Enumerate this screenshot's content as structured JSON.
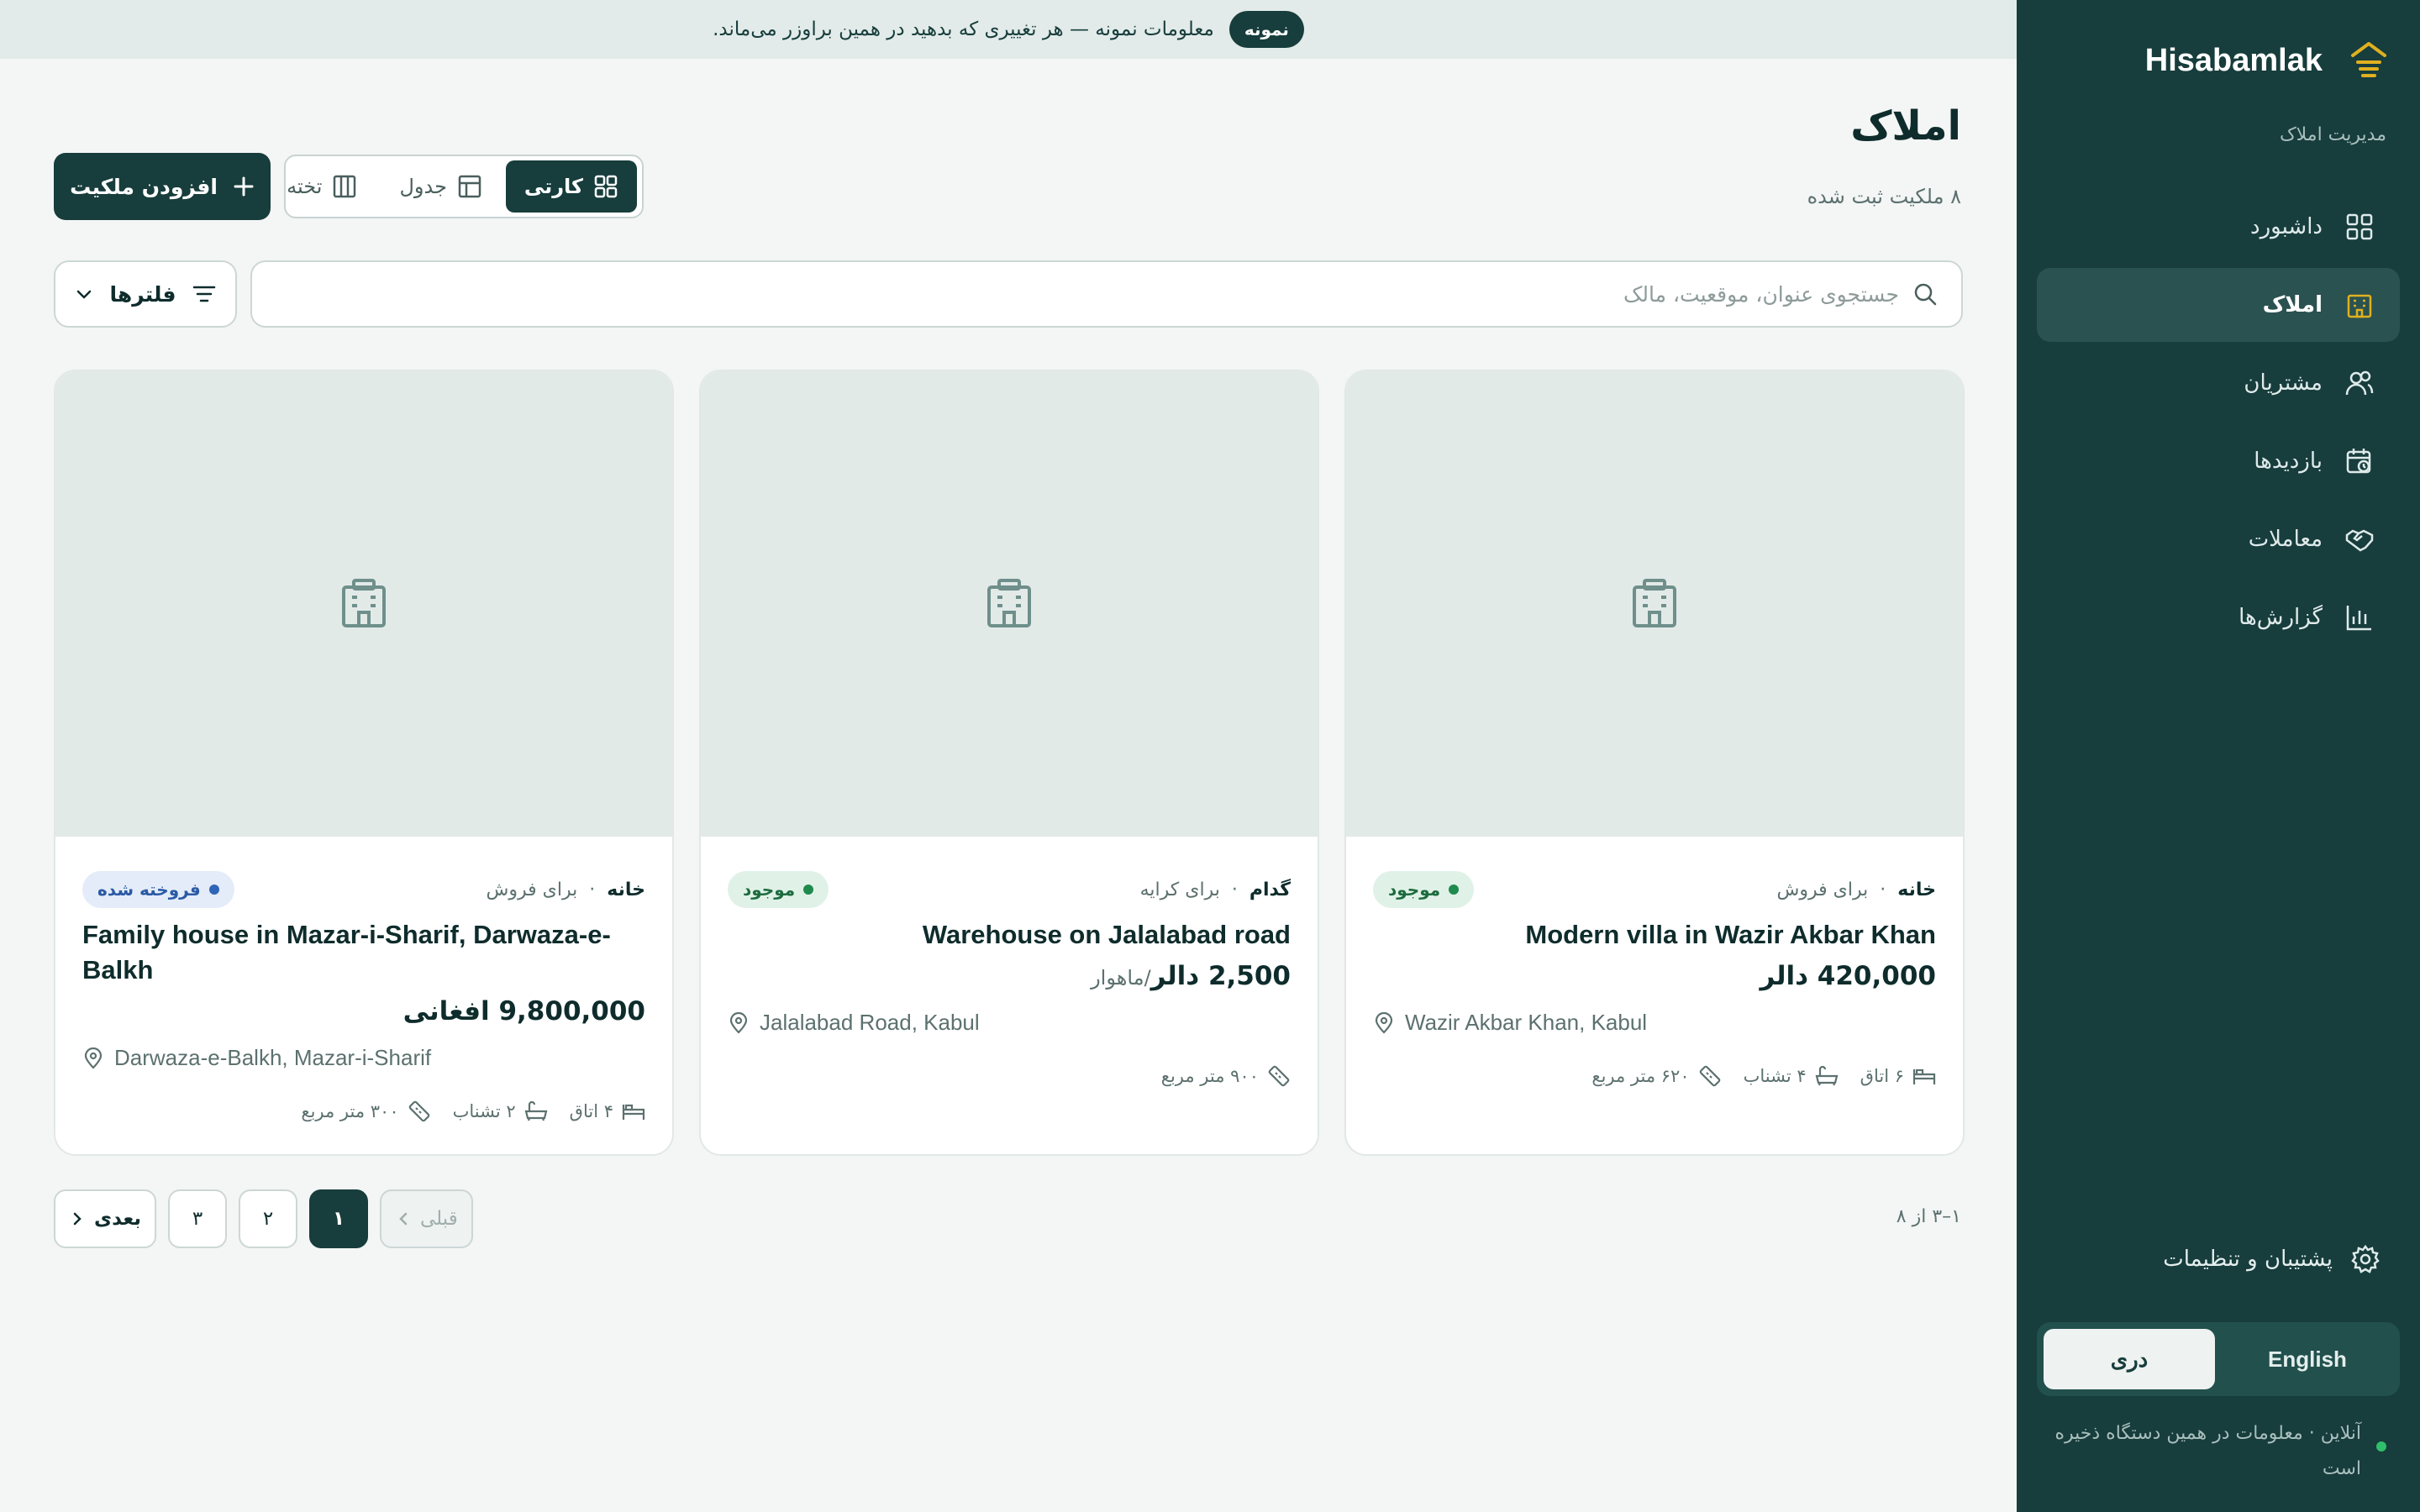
{
  "banner": {
    "pill": "نمونه",
    "text": "معلومات نمونه — هر تغییری که بدهید در همین براوزر می‌ماند."
  },
  "brand": {
    "name": "Hisabamlak",
    "subtitle": "مدیریت املاک"
  },
  "sidebar": {
    "items": [
      {
        "label": "داشبورد",
        "icon": "dashboard-icon"
      },
      {
        "label": "املاک",
        "icon": "building-icon",
        "active": true
      },
      {
        "label": "مشتریان",
        "icon": "users-icon"
      },
      {
        "label": "بازدیدها",
        "icon": "calendar-clock-icon"
      },
      {
        "label": "معاملات",
        "icon": "handshake-icon"
      },
      {
        "label": "گزارش‌ها",
        "icon": "bar-chart-icon"
      }
    ],
    "settings_label": "پشتیبان و تنظیمات",
    "lang": {
      "dari": "دری",
      "english": "English",
      "active": "dari"
    },
    "status": "آنلاین · معلومات در همین دستگاه ذخیره است"
  },
  "page": {
    "title": "املاک",
    "subtitle": "۸ ملکیت ثبت شده"
  },
  "toolbar": {
    "add_label": "افزودن ملکیت",
    "views": {
      "card": "کارتی",
      "table": "جدول",
      "board": "تخته"
    },
    "active_view": "card",
    "search_placeholder": "جستجوی عنوان، موقعیت، مالک",
    "filters_label": "فلترها"
  },
  "properties": [
    {
      "type": "خانه",
      "deal": "برای فروش",
      "status": "موجود",
      "status_kind": "available",
      "title": "Modern villa in Wazir Akbar Khan",
      "price": "420,000 دالر",
      "price_unit": "",
      "location": "Wazir Akbar Khan, Kabul",
      "rooms": "۶ اتاق",
      "baths": "۴ تشناب",
      "area": "۶۲۰ متر مربع"
    },
    {
      "type": "گدام",
      "deal": "برای کرایه",
      "status": "موجود",
      "status_kind": "available",
      "title": "Warehouse on Jalalabad road",
      "price": "2,500 دالر",
      "price_unit": "/ماهوار",
      "location": "Jalalabad Road, Kabul",
      "rooms": "",
      "baths": "",
      "area": "۹۰۰ متر مربع"
    },
    {
      "type": "خانه",
      "deal": "برای فروش",
      "status": "فروخته شده",
      "status_kind": "sold",
      "title": "Family house in Mazar-i-Sharif, Darwaza-e-Balkh",
      "price": "9,800,000 افغانی",
      "price_unit": "",
      "location": "Darwaza-e-Balkh, Mazar-i-Sharif",
      "rooms": "۴ اتاق",
      "baths": "۲ تشناب",
      "area": "۳۰۰ متر مربع"
    }
  ],
  "pagination": {
    "range": "۱–۳ از ۸",
    "prev": "قبلی",
    "pages": [
      "۱",
      "۲",
      "۳"
    ],
    "current": "۱",
    "next": "بعدی"
  },
  "colors": {
    "sidebar": "#173d3c",
    "accent": "#e0b020",
    "available": "#1f8a4d",
    "sold": "#2f65b8"
  }
}
